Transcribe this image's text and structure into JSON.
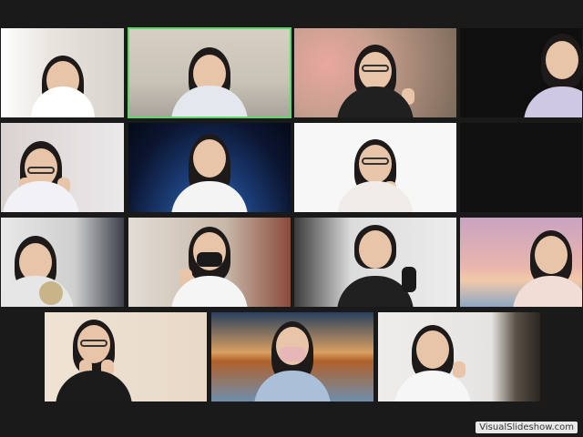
{
  "meeting": {
    "view": "gallery",
    "participant_count": 15,
    "active_speaker_color": "#5ed66b",
    "participants": [
      {
        "tile": 1,
        "background": "#e9e4df",
        "top_color": "#ffffff",
        "accessory": "none"
      },
      {
        "tile": 2,
        "background": "#d9d3c8",
        "top_color": "#e4e8ee",
        "accessory": "none",
        "active": true
      },
      {
        "tile": 3,
        "background": "#c9a08f",
        "top_color": "#202020",
        "accessory": "glasses"
      },
      {
        "tile": 4,
        "background": "#0f0f0f",
        "top_color": "#cfc8e3",
        "accessory": "none"
      },
      {
        "tile": 5,
        "background": "#e5e2e6",
        "top_color": "#f2f2f6",
        "accessory": "glasses"
      },
      {
        "tile": 6,
        "background": "#102040",
        "top_color": "#f4f4f4",
        "accessory": "none"
      },
      {
        "tile": 7,
        "background": "#f5f5f5",
        "top_color": "#f0ede8",
        "accessory": "glasses"
      },
      {
        "tile": 8,
        "background": "#cfcfcf",
        "top_color": "#e6e6e6",
        "accessory": "none"
      },
      {
        "tile": 9,
        "background": "#c8b8a8",
        "top_color": "#f5f5f5",
        "accessory": "mask-black"
      },
      {
        "tile": 10,
        "background": "#dcdcdc",
        "top_color": "#202020",
        "accessory": "none"
      },
      {
        "tile": 11,
        "background": "#d7a9b8",
        "top_color": "#f1ddd5",
        "accessory": "none"
      },
      {
        "tile": 12,
        "background": "#e8d9c8",
        "top_color": "#1b1b1b",
        "accessory": "glasses"
      },
      {
        "tile": 13,
        "background": "#d8a060",
        "top_color": "#aac0d8",
        "accessory": "mask-pink"
      },
      {
        "tile": 14,
        "background": "#e6e4e2",
        "top_color": "#f6f6f6",
        "accessory": "none"
      }
    ]
  },
  "watermark": {
    "text": "VisualSlideshow.com"
  }
}
